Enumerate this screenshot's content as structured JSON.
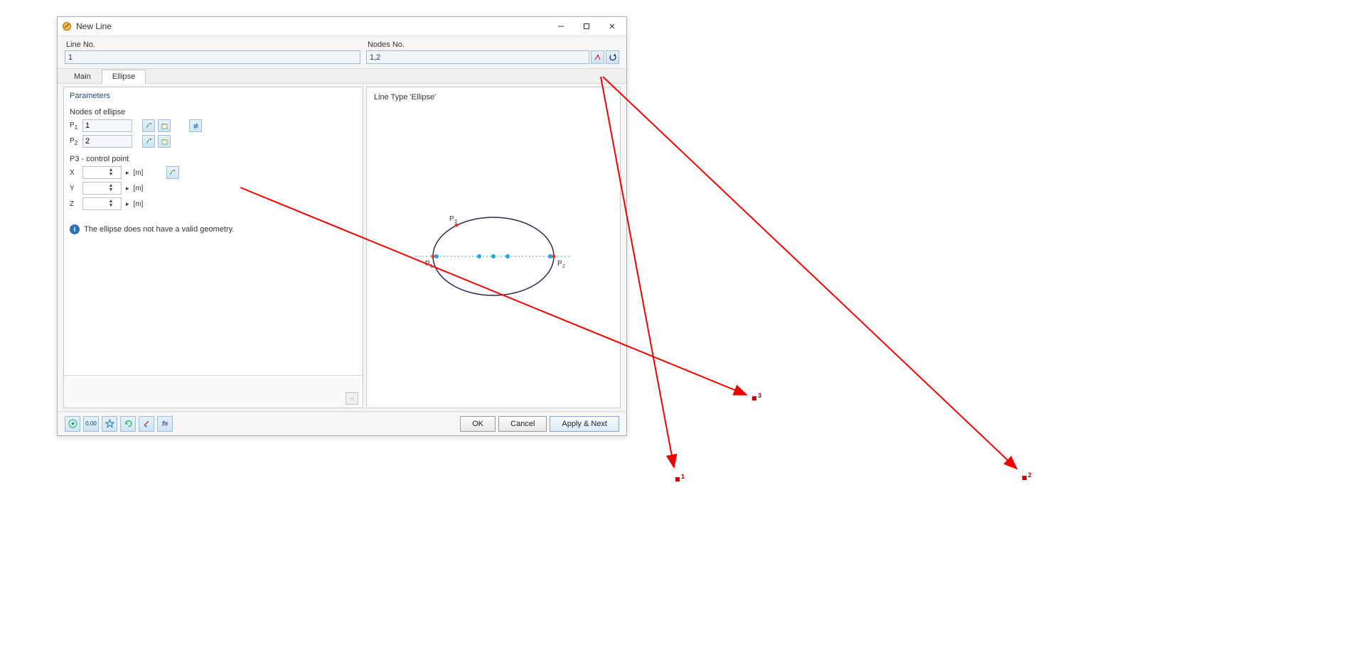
{
  "window": {
    "title": "New Line"
  },
  "header": {
    "line_no_label": "Line No.",
    "line_no_value": "1",
    "nodes_no_label": "Nodes No.",
    "nodes_no_value": "1,2"
  },
  "tabs": {
    "main": "Main",
    "ellipse": "Ellipse",
    "active": "ellipse"
  },
  "parameters": {
    "section_title": "Parameters",
    "nodes_of_ellipse_label": "Nodes of ellipse",
    "p1_label": "P1",
    "p1_value": "1",
    "p2_label": "P2",
    "p2_value": "2",
    "p3_heading": "P3 - control point",
    "x_label": "X",
    "y_label": "Y",
    "z_label": "Z",
    "x_value": "",
    "y_value": "",
    "z_value": "",
    "unit_m": "[m]"
  },
  "validation": {
    "message": "The ellipse does not have a valid geometry."
  },
  "preview": {
    "title": "Line Type 'Ellipse'",
    "p1_label": "P₁",
    "p2_label": "P₂",
    "p3_label": "P₃"
  },
  "buttons": {
    "ok": "OK",
    "cancel": "Cancel",
    "apply_next": "Apply & Next"
  },
  "external_nodes": {
    "n1": "1",
    "n2": "2",
    "n3": "3"
  }
}
